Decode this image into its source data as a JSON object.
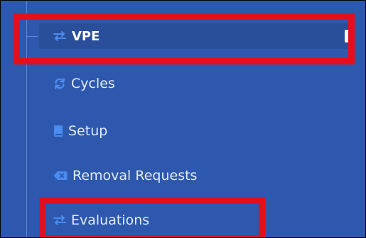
{
  "sidebar": {
    "parent": {
      "label": "VPE",
      "icon": "exchange-arrows-icon"
    },
    "items": [
      {
        "label": "Cycles",
        "icon": "refresh-cycle-icon"
      },
      {
        "label": "Setup",
        "icon": "book-icon"
      },
      {
        "label": "Removal Requests",
        "icon": "backspace-remove-icon"
      },
      {
        "label": "Evaluations",
        "icon": "exchange-arrows-icon"
      }
    ]
  },
  "colors": {
    "sidebar_bg": "#2d58ad",
    "active_row_bg": "#2a4f9a",
    "icon_blue": "#4b8cf0",
    "highlight_red": "#e40f1c",
    "text": "#ffffff"
  }
}
